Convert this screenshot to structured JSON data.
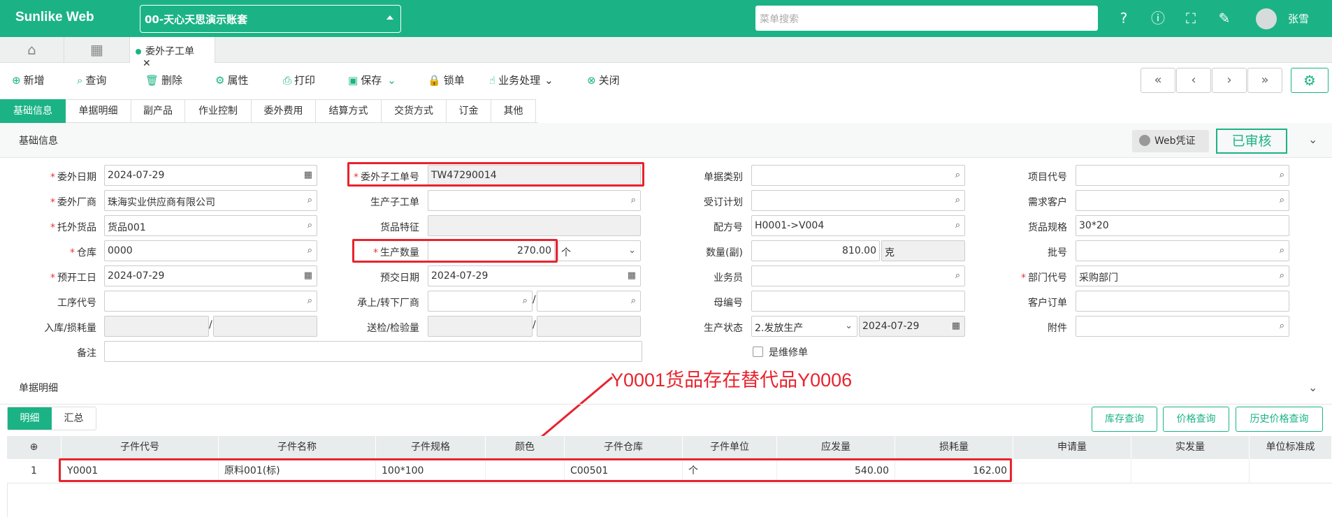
{
  "app": {
    "logo": "Sunlike Web",
    "account": "00-天心天思演示账套",
    "search_placeholder": "菜单搜索",
    "user": "张雪"
  },
  "tabs": {
    "doc_tab": "委外子工单"
  },
  "toolbar": {
    "add": "新增",
    "query": "查询",
    "delete": "删除",
    "props": "属性",
    "print": "打印",
    "save": "保存",
    "lock": "锁单",
    "biz": "业务处理",
    "close": "关闭"
  },
  "subtabs": [
    "基础信息",
    "单据明细",
    "副产品",
    "作业控制",
    "委外费用",
    "结算方式",
    "交货方式",
    "订金",
    "其他"
  ],
  "basic": {
    "title": "基础信息",
    "web_voucher": "Web凭证",
    "status": "已审核"
  },
  "form": {
    "order_date_l": "委外日期",
    "order_date": "2024-07-29",
    "vendor_l": "委外厂商",
    "vendor": "珠海实业供应商有限公司",
    "goods_l": "托外货品",
    "goods": "货品001",
    "wh_l": "仓库",
    "wh": "0000",
    "start_l": "预开工日",
    "start": "2024-07-29",
    "proc_l": "工序代号",
    "instock_l": "入库/损耗量",
    "remark_l": "备注",
    "order_no_l": "委外子工单号",
    "order_no": "TW47290014",
    "sub_order_l": "生产子工单",
    "feature_l": "货品特征",
    "qty_l": "生产数量",
    "qty": "270.00",
    "unit": "个",
    "due_l": "预交日期",
    "due": "2024-07-29",
    "upper_l": "承上/转下厂商",
    "inspect_l": "送检/检验量",
    "bill_type_l": "单据类别",
    "plan_l": "受订计划",
    "recipe_l": "配方号",
    "recipe": "H0001->V004",
    "qty2_l": "数量(副)",
    "qty2": "810.00",
    "unit2": "克",
    "sales_l": "业务员",
    "mother_l": "母编号",
    "state_l": "生产状态",
    "state": "2.发放生产",
    "state_date": "2024-07-29",
    "repair_l": "是维修单",
    "proj_l": "项目代号",
    "demand_l": "需求客户",
    "spec_l": "货品规格",
    "spec": "30*20",
    "batch_l": "批号",
    "dept_l": "部门代号",
    "dept": "采购部门",
    "cust_order_l": "客户订单",
    "attach_l": "附件"
  },
  "annotation": "Y0001货品存在替代品Y0006",
  "detail": {
    "title": "单据明细",
    "tab_detail": "明细",
    "tab_sum": "汇总",
    "btn_stock": "库存查询",
    "btn_price": "价格查询",
    "btn_hist": "历史价格查询",
    "columns": [
      "子件代号",
      "子件名称",
      "子件规格",
      "颜色",
      "子件仓库",
      "子件单位",
      "应发量",
      "损耗量",
      "申请量",
      "实发量",
      "单位标准成"
    ],
    "rows": [
      {
        "no": "1",
        "code": "Y0001",
        "name": "原料001(标)",
        "spec": "100*100",
        "color": "",
        "wh": "C00501",
        "unit": "个",
        "qty": "540.00",
        "loss": "162.00"
      }
    ]
  },
  "colors": {
    "brand": "#1bb385",
    "highlight": "#e8232d"
  }
}
